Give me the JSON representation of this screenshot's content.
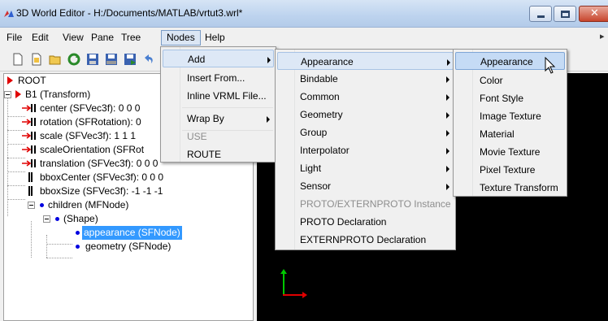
{
  "window": {
    "title": "3D World Editor - H:/Documents/MATLAB/vrtut3.wrl*",
    "colors": {
      "accent": "#3399ff",
      "viewport": "#000000",
      "field_red": "#e00000",
      "node_blue": "#0000e0"
    }
  },
  "menubar": {
    "items": [
      "File",
      "Edit",
      "View",
      "Pane",
      "Tree",
      "Nodes",
      "Help"
    ],
    "active": "Nodes"
  },
  "toolbar": {
    "icons": [
      "new-icon",
      "new-from-template-icon",
      "open-icon",
      "reload-icon",
      "save-icon",
      "save-as-icon",
      "export-icon",
      "undo-icon"
    ]
  },
  "tree": {
    "root": "ROOT",
    "b1": "B1 (Transform)",
    "center": "center (SFVec3f): 0 0 0",
    "rotation": "rotation (SFRotation): 0",
    "scale": "scale (SFVec3f): 1 1 1",
    "scaleOrientation": "scaleOrientation (SFRot",
    "translation": "translation (SFVec3f): 0 0 0",
    "bboxCenter": "bboxCenter (SFVec3f): 0 0 0",
    "bboxSize": "bboxSize (SFVec3f): -1 -1 -1",
    "children": "children (MFNode)",
    "shape": "(Shape)",
    "appearance": "appearance (SFNode)",
    "geometry": "geometry (SFNode)"
  },
  "nodes_menu": {
    "add": "Add",
    "insert_from": "Insert From...",
    "inline_vrml": "Inline VRML File...",
    "wrap_by": "Wrap By",
    "use": "USE",
    "route": "ROUTE"
  },
  "add_menu": {
    "appearance": "Appearance",
    "bindable": "Bindable",
    "common": "Common",
    "geometry": "Geometry",
    "group": "Group",
    "interpolator": "Interpolator",
    "light": "Light",
    "sensor": "Sensor",
    "proto_extern_instance": "PROTO/EXTERNPROTO Instance",
    "proto_declaration": "PROTO Declaration",
    "externproto_declaration": "EXTERNPROTO Declaration"
  },
  "appearance_menu": {
    "appearance": "Appearance",
    "color": "Color",
    "font_style": "Font Style",
    "image_texture": "Image Texture",
    "material": "Material",
    "movie_texture": "Movie Texture",
    "pixel_texture": "Pixel Texture",
    "texture_transform": "Texture Transform"
  }
}
